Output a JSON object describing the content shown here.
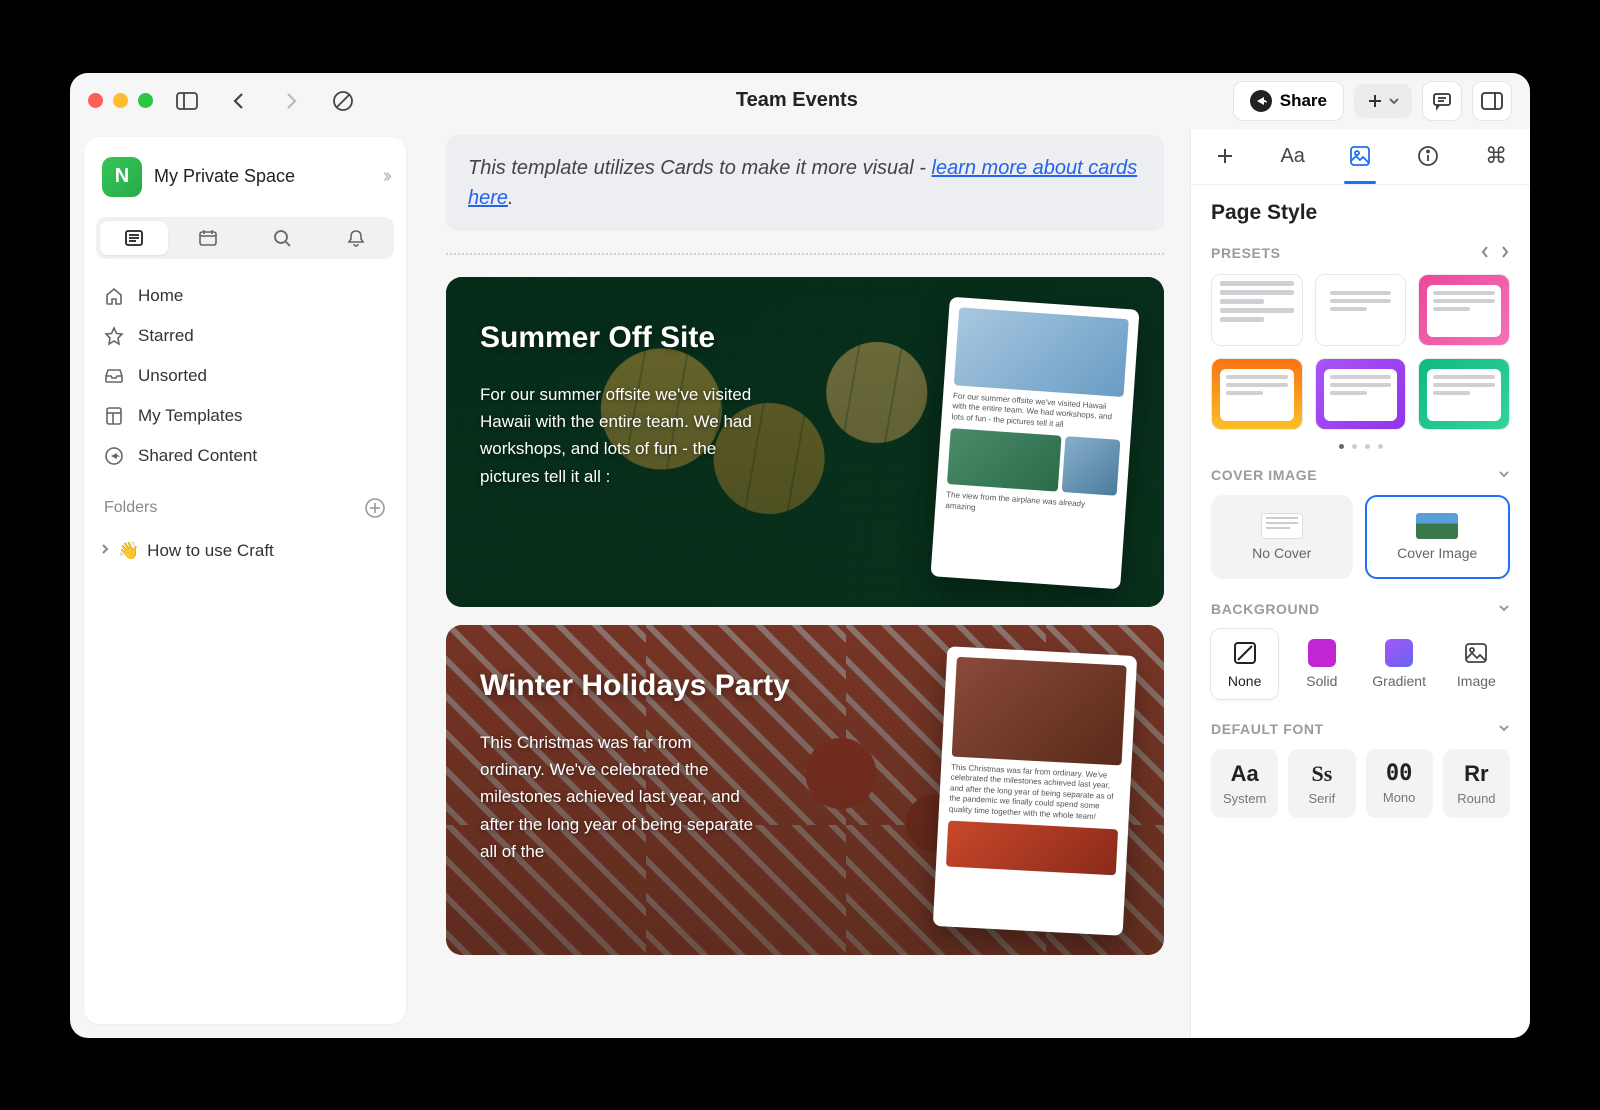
{
  "title": "Team Events",
  "toolbar": {
    "share": "Share"
  },
  "sidebar": {
    "workspace": {
      "initial": "N",
      "name": "My Private Space"
    },
    "items": [
      {
        "label": "Home"
      },
      {
        "label": "Starred"
      },
      {
        "label": "Unsorted"
      },
      {
        "label": "My Templates"
      },
      {
        "label": "Shared Content"
      }
    ],
    "folders_header": "Folders",
    "folder": {
      "emoji": "👋",
      "name": "How to use Craft"
    }
  },
  "main": {
    "hint_prefix": "This template utilizes Cards to make it more visual - ",
    "hint_link": "learn more about cards here",
    "cards": [
      {
        "title": "Summer Off Site",
        "desc": "For our summer offsite we've visited Hawaii with the entire team. We had workshops, and lots of fun - the pictures tell it all :",
        "preview_text": "For our summer offsite we've visited Hawaii with the entire team. We had workshops, and lots of fun - the pictures tell it all",
        "preview_caption": "The view from the airplane was already amazing"
      },
      {
        "title": "Winter Holidays Party",
        "desc": "This Christmas was far from ordinary. We've celebrated the milestones achieved last year, and after the long year of being separate all of the",
        "preview_text": "This Christmas was far from ordinary. We've celebrated the milestones achieved last year, and after the long year of being separate as of the pandemic we finally could spend some quality time together with the whole team!"
      }
    ]
  },
  "panel": {
    "title": "Page Style",
    "presets_header": "PRESETS",
    "preset_gradients": [
      "none",
      "linear-gradient(135deg,#3b82f6,#60a5fa)",
      "linear-gradient(135deg,#ec4899,#f472b6)",
      "linear-gradient(180deg,#f97316,#fbbf24)",
      "linear-gradient(135deg,#a855f7,#9333ea)",
      "linear-gradient(135deg,#10b981,#34d399)"
    ],
    "cover_header": "COVER IMAGE",
    "cover_options": [
      {
        "label": "No Cover"
      },
      {
        "label": "Cover Image"
      }
    ],
    "background_header": "BACKGROUND",
    "background_options": [
      {
        "label": "None"
      },
      {
        "label": "Solid"
      },
      {
        "label": "Gradient"
      },
      {
        "label": "Image"
      }
    ],
    "font_header": "DEFAULT FONT",
    "font_options": [
      {
        "sample": "Aa",
        "label": "System"
      },
      {
        "sample": "Ss",
        "label": "Serif"
      },
      {
        "sample": "00",
        "label": "Mono"
      },
      {
        "sample": "Rr",
        "label": "Round"
      }
    ]
  }
}
